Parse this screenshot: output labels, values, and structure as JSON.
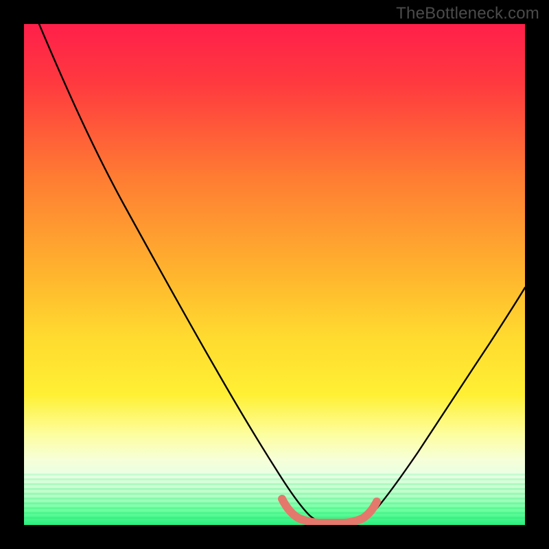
{
  "watermark": "TheBottleneck.com",
  "chart_data": {
    "type": "line",
    "title": "",
    "xlabel": "",
    "ylabel": "",
    "xlim": [
      0,
      100
    ],
    "ylim": [
      0,
      100
    ],
    "gradient_stops": [
      {
        "offset": 0,
        "color": "#ff1f4a"
      },
      {
        "offset": 12,
        "color": "#ff3a3f"
      },
      {
        "offset": 30,
        "color": "#ff7a33"
      },
      {
        "offset": 50,
        "color": "#ffb52e"
      },
      {
        "offset": 62,
        "color": "#ffd92f"
      },
      {
        "offset": 74,
        "color": "#fff034"
      },
      {
        "offset": 82,
        "color": "#fdfea0"
      },
      {
        "offset": 87,
        "color": "#f6ffd8"
      },
      {
        "offset": 90,
        "color": "#e9ffe3"
      },
      {
        "offset": 94,
        "color": "#b8ffc8"
      },
      {
        "offset": 97,
        "color": "#6effa0"
      },
      {
        "offset": 100,
        "color": "#27f07d"
      }
    ],
    "series": [
      {
        "name": "bottleneck-curve",
        "color": "#000000",
        "x": [
          3,
          8,
          14,
          20,
          26,
          32,
          38,
          44,
          49,
          53,
          56,
          60,
          64,
          68,
          72,
          78,
          85,
          92,
          100
        ],
        "values": [
          100,
          88,
          76,
          64,
          52,
          40,
          29,
          18,
          10,
          4,
          1,
          0,
          0,
          1,
          5,
          12,
          22,
          34,
          48
        ]
      },
      {
        "name": "optimal-zone-marker",
        "color": "#e4786c",
        "x": [
          51,
          53,
          55,
          57,
          60,
          63,
          66,
          68,
          70
        ],
        "values": [
          5,
          3,
          2,
          1,
          1,
          1,
          1,
          2,
          4
        ]
      }
    ]
  }
}
